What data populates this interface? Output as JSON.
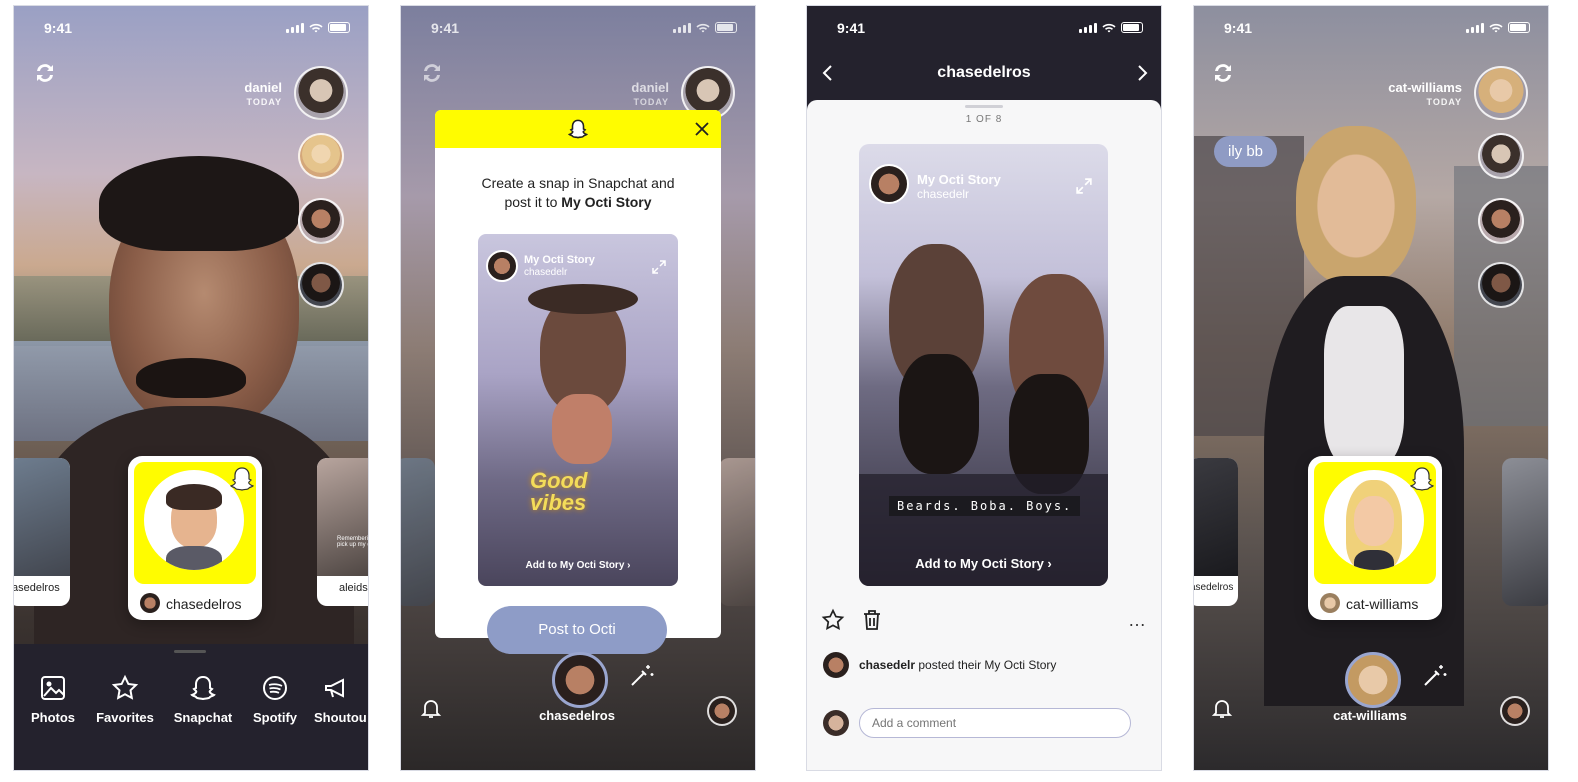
{
  "screens": [
    {
      "time": "9:41",
      "friend_name": "daniel",
      "friend_time": "TODAY",
      "card_name": "chasedelros",
      "left_card_name": "asedelros",
      "right_card_name": "aleids",
      "right_card_text": "Remembering\npick up my dog",
      "tabs": [
        {
          "label": "Photos",
          "icon": "photos-icon"
        },
        {
          "label": "Favorites",
          "icon": "star-icon"
        },
        {
          "label": "Snapchat",
          "icon": "ghost-icon"
        },
        {
          "label": "Spotify",
          "icon": "spotify-icon"
        },
        {
          "label": "Shoutou",
          "icon": "megaphone-icon"
        }
      ]
    },
    {
      "time": "9:41",
      "friend_name": "daniel",
      "friend_time": "TODAY",
      "modal_text": "Create a snap in Snapchat and",
      "modal_text2_prefix": "post it to ",
      "modal_text2_bold": "My Octi Story",
      "preview_title": "My Octi Story",
      "preview_user": "chasedelr",
      "preview_sticker": "Good vibes",
      "preview_cta": "Add to My Octi Story",
      "post_button": "Post to Octi",
      "bottom_name": "chasedelros"
    },
    {
      "time": "9:41",
      "header_title": "chasedelros",
      "counter": "1 OF 8",
      "story_title": "My Octi Story",
      "story_user": "chasedelr",
      "caption": "Beards. Boba. Boys.",
      "story_cta": "Add to My Octi Story",
      "post_user": "chasedelr",
      "post_text": " posted their My Octi Story",
      "comment_placeholder": "Add a comment"
    },
    {
      "time": "9:41",
      "friend_name": "cat-williams",
      "friend_time": "TODAY",
      "chat_bubble": "ily bb",
      "card_name": "cat-williams",
      "left_card_name": "asedelros",
      "bottom_name": "cat-williams"
    }
  ],
  "colors": {
    "snap_yellow": "#fffc00",
    "dark": "#24222d",
    "octi_button": "#8e9cc7"
  }
}
